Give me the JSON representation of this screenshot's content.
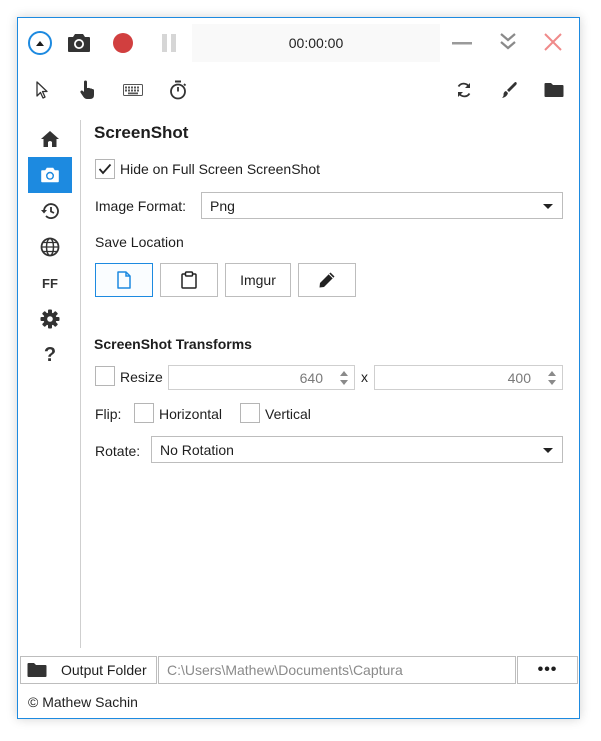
{
  "titlebar": {
    "timer": "00:00:00"
  },
  "sidebar": {
    "items": [
      {
        "icon": "home-icon"
      },
      {
        "icon": "camera-icon",
        "active": true
      },
      {
        "icon": "history-icon"
      },
      {
        "icon": "globe-icon"
      },
      {
        "label": "FF"
      },
      {
        "icon": "gear-icon"
      },
      {
        "label": "?"
      }
    ]
  },
  "screenshot": {
    "title": "ScreenShot",
    "hide_fullscreen_label": "Hide on Full Screen ScreenShot",
    "hide_fullscreen_checked": true,
    "image_format_label": "Image Format:",
    "image_format_value": "Png",
    "save_location_label": "Save Location",
    "imgur_label": "Imgur"
  },
  "transforms": {
    "title": "ScreenShot Transforms",
    "resize_label": "Resize",
    "resize_checked": false,
    "width": "640",
    "x_label": "x",
    "height": "400",
    "flip_label": "Flip:",
    "horizontal_label": "Horizontal",
    "vertical_label": "Vertical",
    "rotate_label": "Rotate:",
    "rotate_value": "No Rotation"
  },
  "bottom": {
    "output_folder_label": "Output Folder",
    "output_path": "C:\\Users\\Mathew\\Documents\\Captura",
    "more_label": "•••",
    "copyright": "© Mathew Sachin"
  },
  "colors": {
    "accent": "#1d8ae0",
    "record": "#d13f3f",
    "close": "#f08a8a"
  }
}
